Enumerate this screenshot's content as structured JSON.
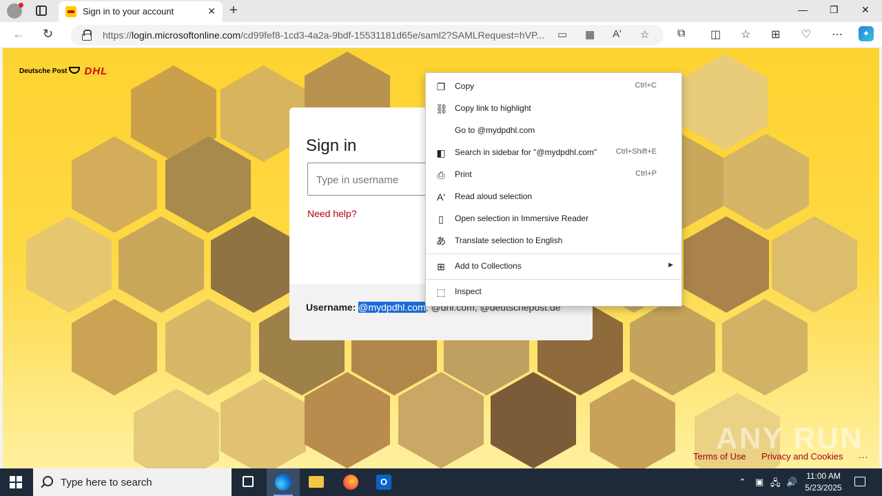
{
  "browser": {
    "tab_title": "Sign in to your account",
    "url_prefix": "https://",
    "url_host": "login.microsoftonline.com",
    "url_path": "/cd99fef8-1cd3-4a2a-9bdf-15531181d65e/saml2?SAMLRequest=hVP..."
  },
  "page": {
    "logo_left": "Deutsche Post",
    "logo_right": "DHL",
    "sign_in_title": "Sign in",
    "username_placeholder": "Type in username",
    "need_help": "Need help?",
    "footer_label": "Username:",
    "footer_selected": "@mydpdhl.com",
    "footer_rest": ", @dhl.com, @deutschepost.de",
    "terms": "Terms of Use",
    "privacy": "Privacy and Cookies",
    "more": "...",
    "watermark": "ANY RUN"
  },
  "context_menu": {
    "items": [
      {
        "label": "Copy",
        "shortcut": "Ctrl+C",
        "icon": "copy-icon"
      },
      {
        "label": "Copy link to highlight",
        "shortcut": "",
        "icon": "link-highlight-icon"
      },
      {
        "label": "Go to @mydpdhl.com",
        "shortcut": "",
        "icon": ""
      },
      {
        "label": "Search in sidebar for \"@mydpdhl.com\"",
        "shortcut": "Ctrl+Shift+E",
        "icon": "sidebar-search-icon"
      },
      {
        "label": "Print",
        "shortcut": "Ctrl+P",
        "icon": "print-icon"
      },
      {
        "label": "Read aloud selection",
        "shortcut": "",
        "icon": "read-aloud-icon"
      },
      {
        "label": "Open selection in Immersive Reader",
        "shortcut": "",
        "icon": "immersive-reader-icon"
      },
      {
        "label": "Translate selection to English",
        "shortcut": "",
        "icon": "translate-icon"
      },
      {
        "label": "Add to Collections",
        "shortcut": "",
        "icon": "collections-icon"
      },
      {
        "label": "Inspect",
        "shortcut": "",
        "icon": "inspect-icon"
      }
    ]
  },
  "taskbar": {
    "search_placeholder": "Type here to search",
    "time": "11:00 AM",
    "date": "5/23/2025"
  },
  "colors": {
    "dhl_yellow": "#ffcc00",
    "dhl_red": "#d40511",
    "selection": "#1a6ad6",
    "taskbar": "#1e2a3a"
  }
}
